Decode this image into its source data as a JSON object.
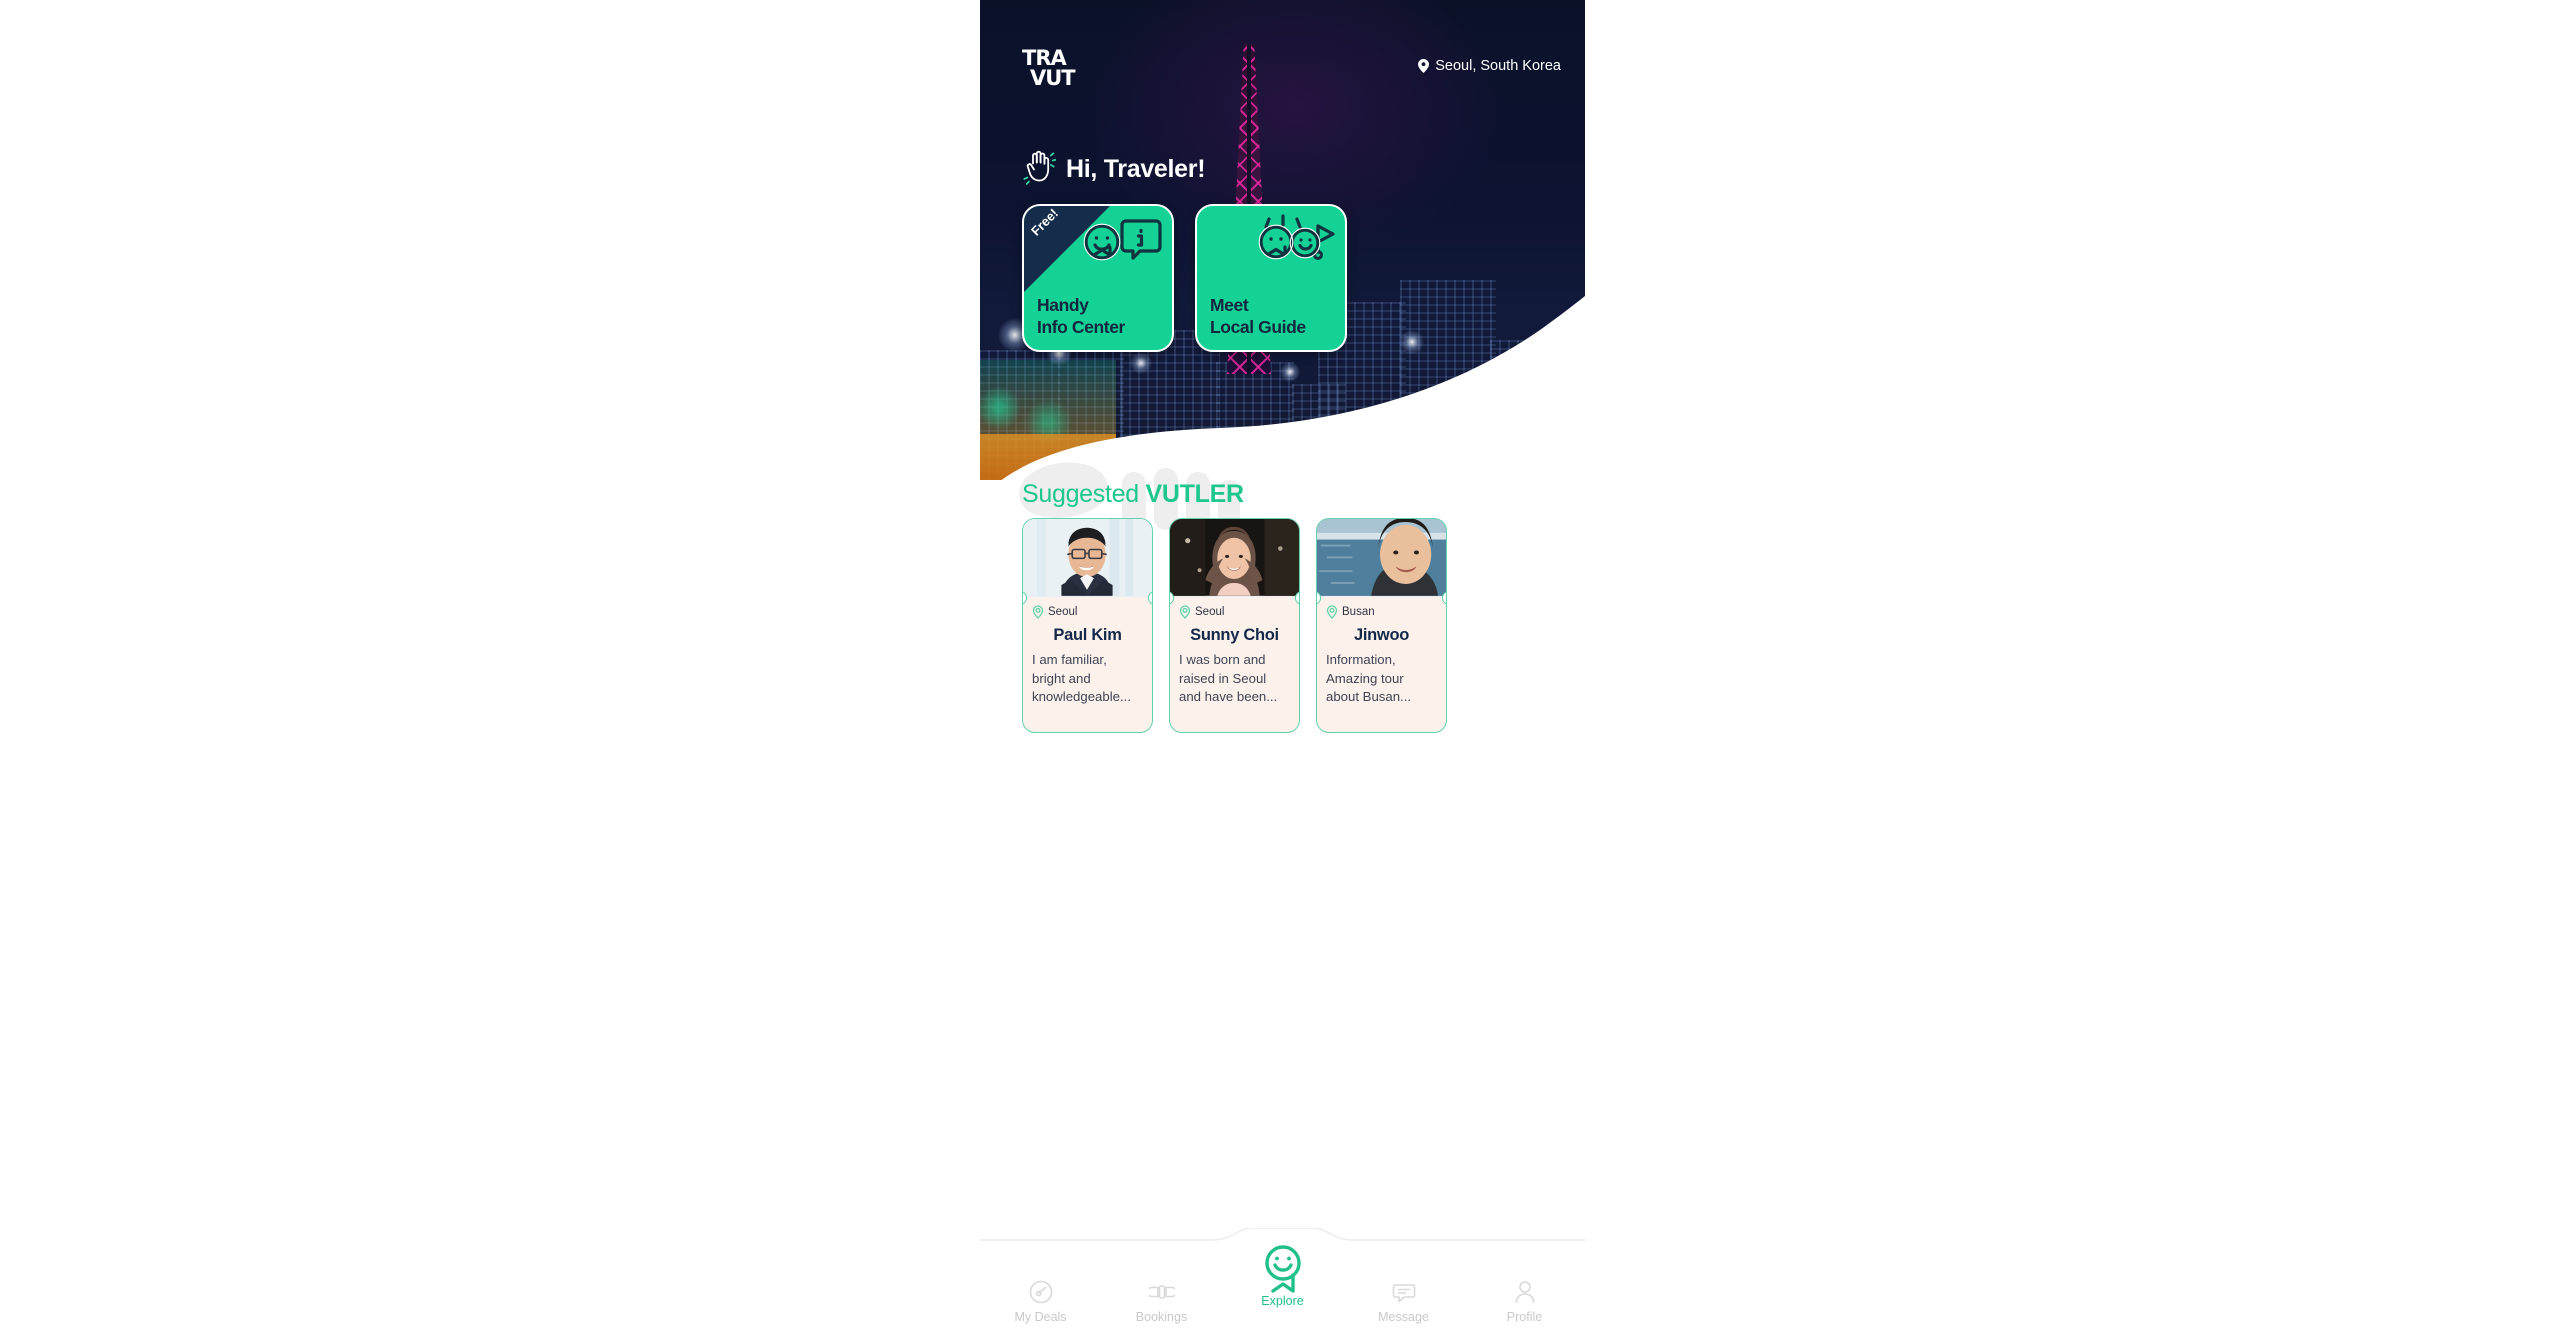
{
  "app": {
    "logo_line1": "TRA",
    "logo_line2": "VUT",
    "location": "Seoul, South Korea",
    "location_icon": "map-pin-icon"
  },
  "greeting": {
    "text": "Hi, Traveler!",
    "icon": "waving-hand-icon"
  },
  "action_cards": [
    {
      "title": "Handy\nInfo Center",
      "title_line1": "Handy",
      "title_line2": "Info Center",
      "badge": "Free!",
      "icon": "smiley-info-bubble-icon",
      "bg": "#14d195"
    },
    {
      "title": "Meet\nLocal Guide",
      "title_line1": "Meet",
      "title_line2": "Local Guide",
      "badge": "",
      "icon": "two-smileys-flag-icon",
      "bg": "#14d195"
    }
  ],
  "suggested": {
    "title_regular": "Suggested ",
    "title_bold": "VUTLER",
    "accent": "#1ec78e",
    "guides": [
      {
        "city": "Seoul",
        "name": "Paul Kim",
        "description": "I am familiar, bright and knowledgeable...",
        "photo_alt": "man-with-glasses-portrait"
      },
      {
        "city": "Seoul",
        "name": "Sunny Choi",
        "description": "I was born and raised in Seoul and have been...",
        "photo_alt": "woman-smiling-portrait"
      },
      {
        "city": "Busan",
        "name": "Jinwoo",
        "description": "Information, Amazing tour about Busan...",
        "photo_alt": "man-by-waterfront-portrait"
      }
    ]
  },
  "bottom_nav": {
    "items": [
      {
        "label": "My Deals",
        "icon": "speedometer-icon",
        "active": false
      },
      {
        "label": "Bookings",
        "icon": "ticket-icon",
        "active": false
      },
      {
        "label": "Explore",
        "icon": "smiley-mascot-icon",
        "active": true
      },
      {
        "label": "Message",
        "icon": "chat-bubble-icon",
        "active": false
      },
      {
        "label": "Profile",
        "icon": "person-icon",
        "active": false
      }
    ],
    "active_color": "#21c08b",
    "inactive_color": "#c9c9c9"
  }
}
